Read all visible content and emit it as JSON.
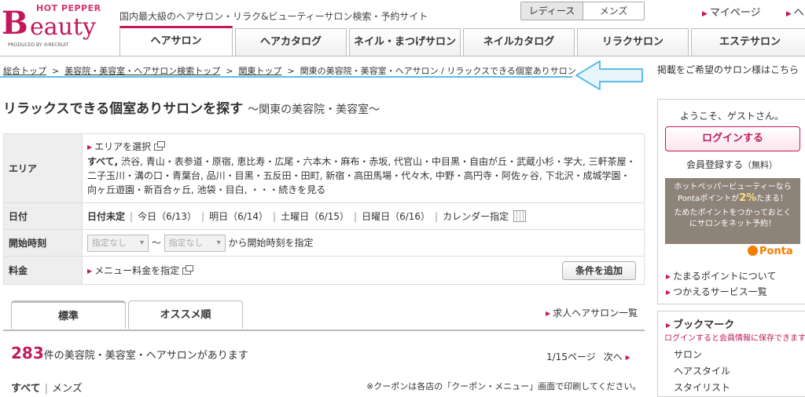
{
  "header": {
    "logo_top": "HOT PEPPER",
    "logo_b": "B",
    "logo_rest": "eauty",
    "logo_produced": "PRODUCED BY ®RECRUIT",
    "tagline": "国内最大級のヘアサロン・リラク&ビューティーサロン検索・予約サイト",
    "gender_tabs": [
      "レディース",
      "メンズ"
    ],
    "top_links": [
      "マイページ",
      "ヘルプ"
    ],
    "nav_tabs": [
      "ヘアサロン",
      "ヘアカタログ",
      "ネイル・まつげサロン",
      "ネイルカタログ",
      "リラクサロン",
      "エステサロン"
    ]
  },
  "breadcrumb": {
    "items": [
      "総合トップ",
      "美容院・美容室・ヘアサロン検索トップ",
      "関東トップ"
    ],
    "current": "関東の美容院・美容室・ヘアサロン / リラックスできる個室ありサロン",
    "separator": ">",
    "right_notice": "掲載をご希望のサロン様はこちら"
  },
  "main": {
    "title": "リラックスできる個室ありサロンを探す",
    "subtitle": "～関東の美容院・美容室～",
    "search": {
      "area_label": "エリア",
      "area_select": "エリアを選択",
      "area_all": "すべて,",
      "area_list": " 渋谷, 青山・表参道・原宿, 恵比寿・広尾・六本木・麻布・赤坂, 代官山・中目黒・自由が丘・武蔵小杉・学大, 三軒茶屋・二子玉川・溝の口・青葉台, 品川・目黒・五反田・田町, 新宿・高田馬場・代々木, 中野・高円寺・阿佐ヶ谷, 下北沢・成城学園・向ヶ丘遊園・新百合ヶ丘, 池袋・目白, ・・・続きを見る",
      "date_label": "日付",
      "dates": [
        "日付未定",
        "今日（6/13）",
        "明日（6/14）",
        "土曜日（6/15）",
        "日曜日（6/16）",
        "カレンダー指定"
      ],
      "time_label": "開始時刻",
      "time_from": "指定なし",
      "time_to": "指定なし",
      "time_tilde": "～",
      "time_suffix": "から開始時刻を指定",
      "price_label": "料金",
      "price_link": "メニュー料金を指定",
      "add_condition": "条件を追加"
    },
    "sort_tabs": [
      "標準",
      "オススメ順"
    ],
    "job_link": "求人ヘアサロン一覧",
    "result_count": "283",
    "result_text": "件の美容院・美容室・ヘアサロンがあります",
    "pager_text": "1/15ページ",
    "pager_next": "次へ",
    "filter": [
      "すべて",
      "メンズ"
    ],
    "print_note": "※クーポンは各店の「クーポン・メニュー」画面で印刷してください。"
  },
  "sidebar": {
    "welcome": "ようこそ、ゲストさん。",
    "login": "ログインする",
    "register": "会員登録する",
    "register_free": "（無料）",
    "ponta_line1": "ホットペッパービューティーなら",
    "ponta_line2a": "Pontaポイントが",
    "ponta_pct": "2%",
    "ponta_line2b": "たまる！",
    "ponta_line3": "ためたポイントをつかっておとく",
    "ponta_line4": "にサロンをネット予約！",
    "ponta_logo": "Ponta",
    "links": [
      "たまるポイントについて",
      "つかえるサービス一覧"
    ],
    "bookmark_title": "ブックマーク",
    "bookmark_note": "ログインすると会員情報に保存できます",
    "bookmark_items": [
      "サロン",
      "ヘアスタイル",
      "スタイリスト"
    ]
  },
  "colors": {
    "accent": "#c2185b",
    "highlight_arrow": "#5bbde6",
    "label_bg": "#eeeeee"
  }
}
